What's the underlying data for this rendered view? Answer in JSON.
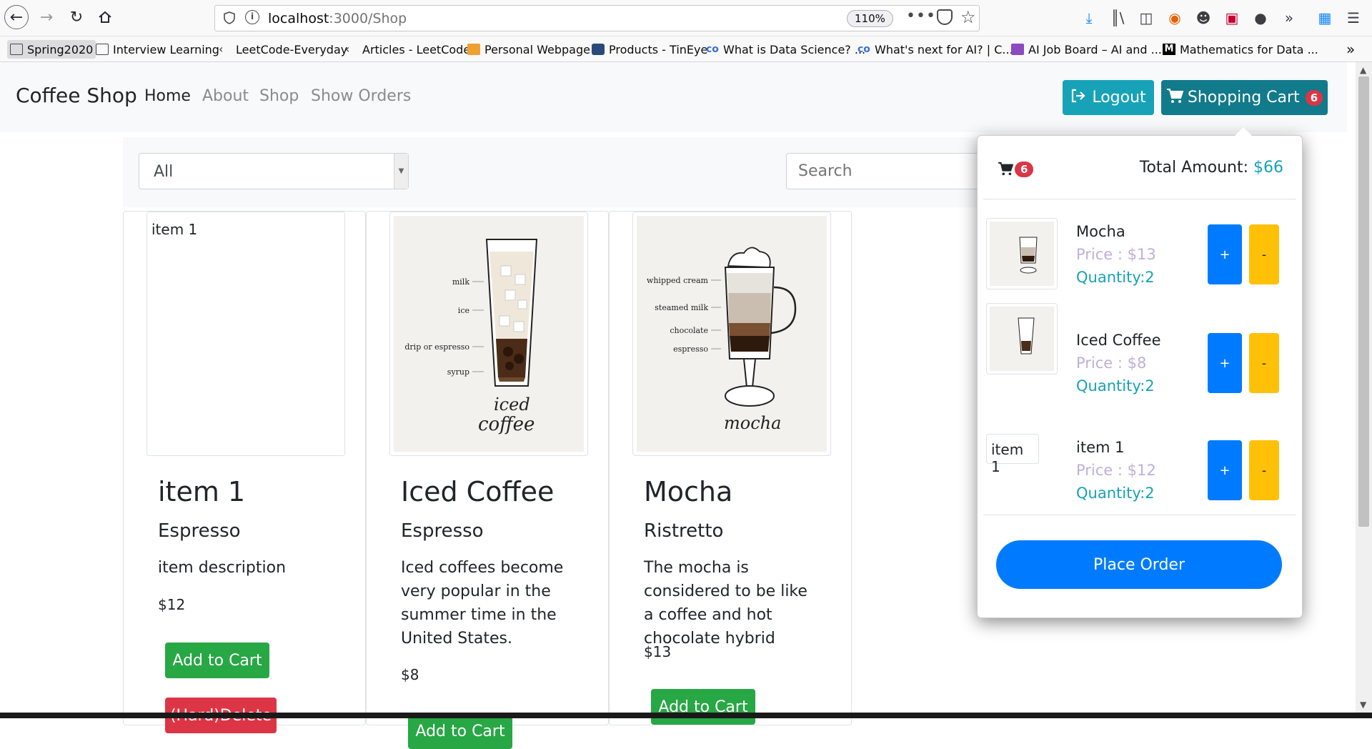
{
  "browser": {
    "url_host": "localhost",
    "url_path": ":3000/Shop",
    "zoom": "110%",
    "bookmarks": [
      "Spring2020",
      "Interview Learning",
      "LeetCode-Everyday",
      "Articles - LeetCode",
      "Personal Webpage",
      "Products - TinEye",
      "What is Data Science? ...",
      "What's next for AI? | C...",
      "AI Job Board – AI and ...",
      "Mathematics for Data ..."
    ]
  },
  "navbar": {
    "brand": "Coffee Shop",
    "links": [
      "Home",
      "About",
      "Shop",
      "Show Orders"
    ],
    "logout": "Logout",
    "cart_label": "Shopping Cart",
    "cart_count": "6"
  },
  "filter": {
    "category": "All",
    "search_placeholder": "Search"
  },
  "products": [
    {
      "name": "item 1",
      "image_alt": "item 1",
      "type": "Espresso",
      "description": "item description",
      "price": "$12",
      "add_label": "Add to Cart",
      "delete_label": "(Hard)Delete"
    },
    {
      "name": "Iced Coffee",
      "type": "Espresso",
      "description": "Iced coffees become very popular in the summer time in the United States.",
      "price": "$8",
      "add_label": "Add to Cart",
      "image_labels": [
        "milk",
        "ice",
        "drip or espresso",
        "syrup",
        "iced",
        "coffee"
      ]
    },
    {
      "name": "Mocha",
      "type": "Ristretto",
      "description": "The mocha is considered to be like a coffee and hot chocolate hybrid",
      "price": "$13",
      "add_label": "Add to Cart",
      "image_labels": [
        "whipped cream",
        "steamed milk",
        "chocolate",
        "espresso",
        "mocha"
      ]
    }
  ],
  "cart": {
    "count": "6",
    "total_label": "Total Amount:",
    "total_value": "$66",
    "items": [
      {
        "name": "Mocha",
        "price": "Price : $13",
        "quantity": "Quantity:2"
      },
      {
        "name": "Iced Coffee",
        "price": "Price : $8",
        "quantity": "Quantity:2"
      },
      {
        "name": "item 1",
        "price": "Price : $12",
        "quantity": "Quantity:2",
        "image_alt": "item 1"
      }
    ],
    "plus": "+",
    "minus": "-",
    "place_order": "Place Order"
  },
  "colors": {
    "info": "#17a2b8",
    "success": "#28a745",
    "danger": "#dc3545",
    "primary": "#007bff",
    "warning": "#ffc107"
  }
}
